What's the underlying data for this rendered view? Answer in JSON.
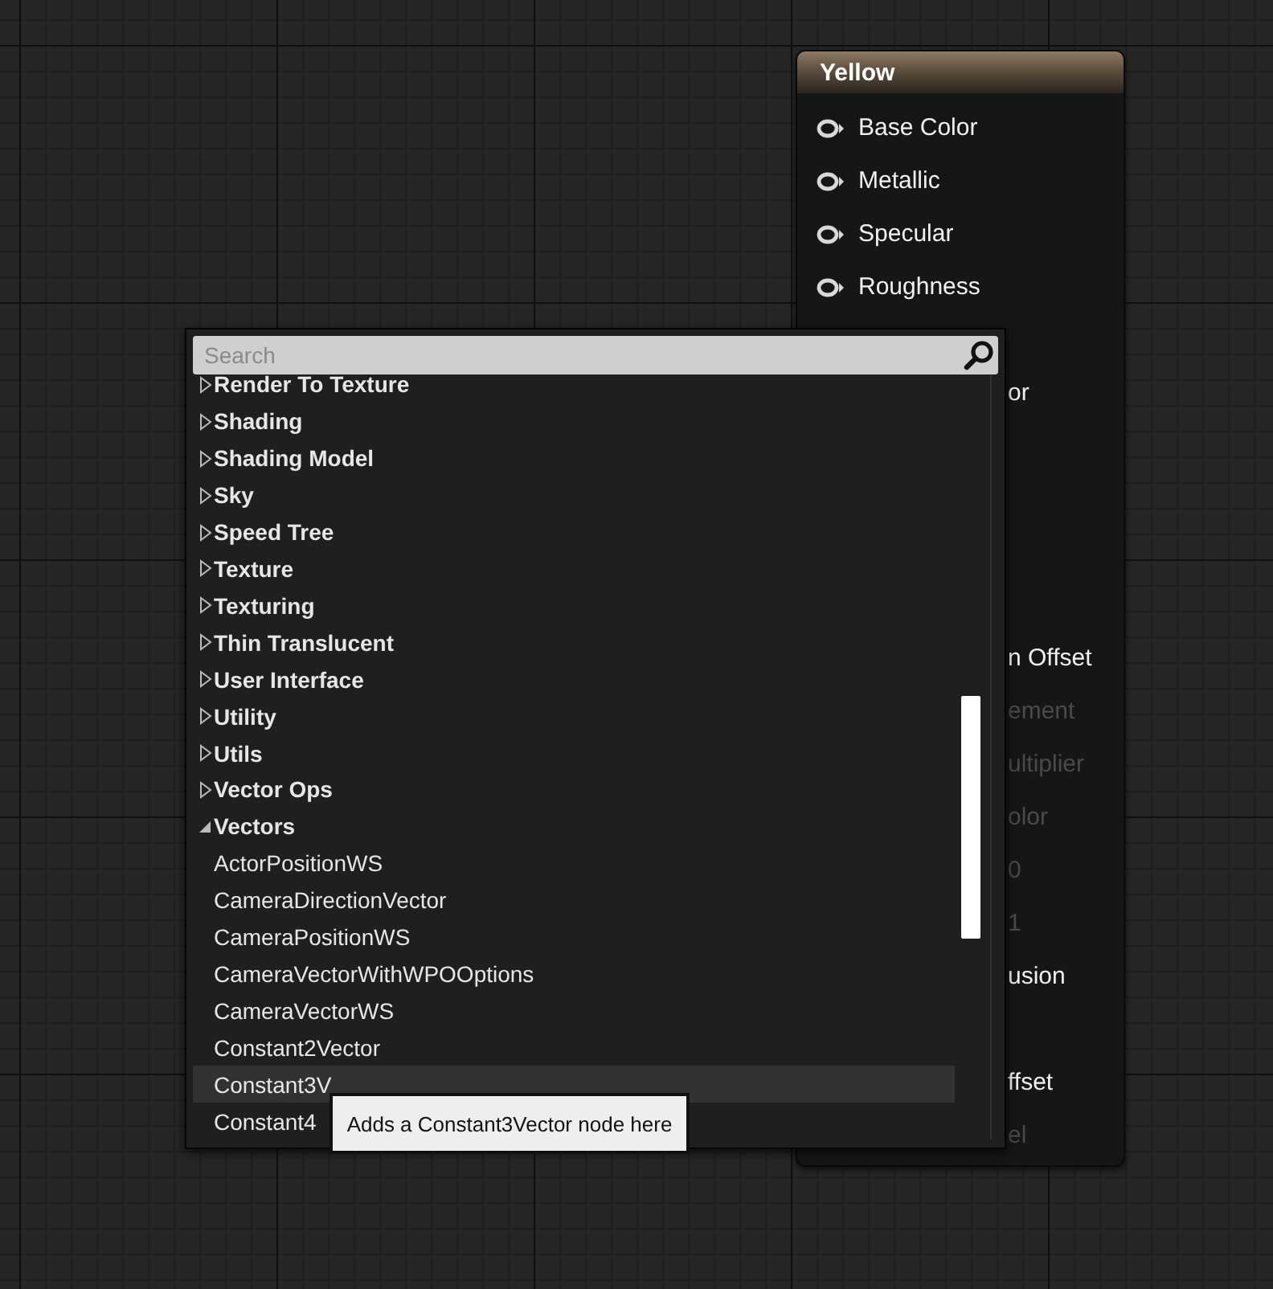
{
  "node": {
    "title": "Yellow",
    "pins": [
      {
        "kind": "pin",
        "label": "Base Color",
        "disabled": false
      },
      {
        "kind": "pin",
        "label": "Metallic",
        "disabled": false
      },
      {
        "kind": "pin",
        "label": "Specular",
        "disabled": false
      },
      {
        "kind": "pin",
        "label": "Roughness",
        "disabled": false
      },
      {
        "kind": "covered"
      },
      {
        "kind": "clipped",
        "label": "or",
        "disabled": false
      },
      {
        "kind": "covered"
      },
      {
        "kind": "covered"
      },
      {
        "kind": "covered"
      },
      {
        "kind": "covered"
      },
      {
        "kind": "clipped",
        "label": "n Offset",
        "disabled": false
      },
      {
        "kind": "clipped",
        "label": "ement",
        "disabled": true
      },
      {
        "kind": "clipped",
        "label": "ultiplier",
        "disabled": true
      },
      {
        "kind": "clipped",
        "label": "olor",
        "disabled": true
      },
      {
        "kind": "clipped",
        "label": "0",
        "disabled": true
      },
      {
        "kind": "clipped",
        "label": "1",
        "disabled": true
      },
      {
        "kind": "clipped",
        "label": "usion",
        "disabled": false
      },
      {
        "kind": "covered"
      },
      {
        "kind": "clipped",
        "label": "ffset",
        "disabled": false
      },
      {
        "kind": "clipped",
        "label": "el",
        "disabled": true
      }
    ]
  },
  "action_menu": {
    "search": {
      "placeholder": "Search"
    },
    "items": [
      {
        "kind": "category",
        "label": "Render To Texture",
        "expanded": false,
        "selected": false
      },
      {
        "kind": "category",
        "label": "Shading",
        "expanded": false,
        "selected": false
      },
      {
        "kind": "category",
        "label": "Shading Model",
        "expanded": false,
        "selected": false
      },
      {
        "kind": "category",
        "label": "Sky",
        "expanded": false,
        "selected": false
      },
      {
        "kind": "category",
        "label": "Speed Tree",
        "expanded": false,
        "selected": false
      },
      {
        "kind": "category",
        "label": "Texture",
        "expanded": false,
        "selected": false
      },
      {
        "kind": "category",
        "label": "Texturing",
        "expanded": false,
        "selected": false
      },
      {
        "kind": "category",
        "label": "Thin Translucent",
        "expanded": false,
        "selected": false
      },
      {
        "kind": "category",
        "label": "User Interface",
        "expanded": false,
        "selected": false
      },
      {
        "kind": "category",
        "label": "Utility",
        "expanded": false,
        "selected": false
      },
      {
        "kind": "category",
        "label": "Utils",
        "expanded": false,
        "selected": false
      },
      {
        "kind": "category",
        "label": "Vector Ops",
        "expanded": false,
        "selected": false
      },
      {
        "kind": "category",
        "label": "Vectors",
        "expanded": true,
        "selected": false,
        "children": [
          {
            "kind": "node",
            "label": "ActorPositionWS",
            "selected": false
          },
          {
            "kind": "node",
            "label": "CameraDirectionVector",
            "selected": false
          },
          {
            "kind": "node",
            "label": "CameraPositionWS",
            "selected": false
          },
          {
            "kind": "node",
            "label": "CameraVectorWithWPOOptions",
            "selected": false
          },
          {
            "kind": "node",
            "label": "CameraVectorWS",
            "selected": false
          },
          {
            "kind": "node",
            "label": "Constant2Vector",
            "selected": false
          },
          {
            "kind": "node",
            "label": "Constant3V",
            "selected": true
          },
          {
            "kind": "node",
            "label": "Constant4",
            "selected": false
          }
        ]
      }
    ]
  },
  "tooltip": {
    "text": "Adds a Constant3Vector node here"
  }
}
